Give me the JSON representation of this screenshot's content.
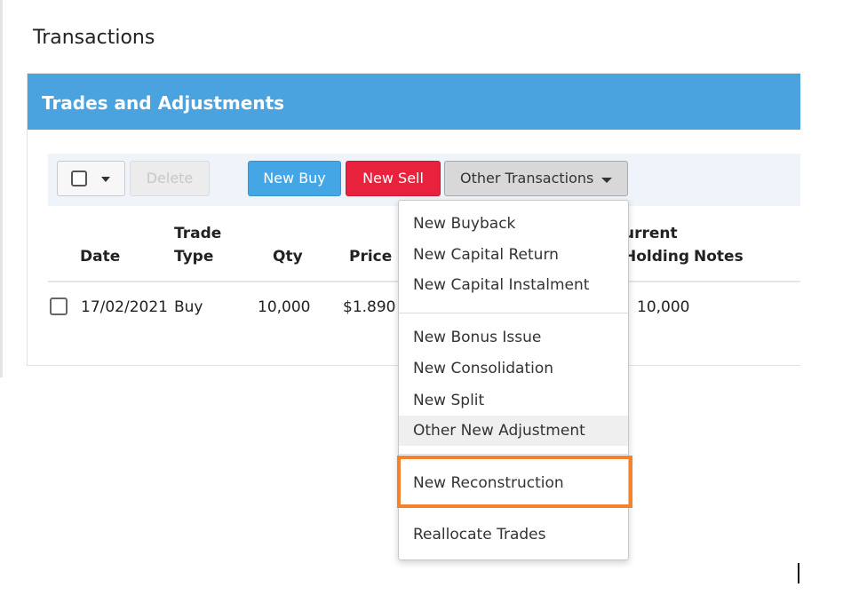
{
  "page": {
    "title": "Transactions"
  },
  "panel": {
    "title": "Trades and Adjustments"
  },
  "toolbar": {
    "delete_label": "Delete",
    "new_buy_label": "New Buy",
    "new_sell_label": "New Sell",
    "other_transactions_label": "Other Transactions"
  },
  "table": {
    "headers": {
      "date": "Date",
      "trade_type_line1": "Trade",
      "trade_type_line2": "Type",
      "qty": "Qty",
      "price": "Price",
      "current_holding_line1": "urrent",
      "current_holding_line2": "Holding",
      "notes": "Notes"
    },
    "rows": [
      {
        "date": "17/02/2021",
        "trade_type": "Buy",
        "qty": "10,000",
        "price": "$1.890",
        "current_holding": "10,000",
        "notes": ""
      }
    ]
  },
  "dropdown": {
    "items": [
      "New Buyback",
      "New Capital Return",
      "New Capital Instalment",
      "New Bonus Issue",
      "New Consolidation",
      "New Split",
      "Other New Adjustment",
      "New Reconstruction",
      "Reallocate Trades"
    ]
  },
  "colors": {
    "panel_header": "#4aa3df",
    "new_buy": "#45a6e6",
    "new_sell": "#e8213d",
    "highlight": "#f5822a"
  }
}
